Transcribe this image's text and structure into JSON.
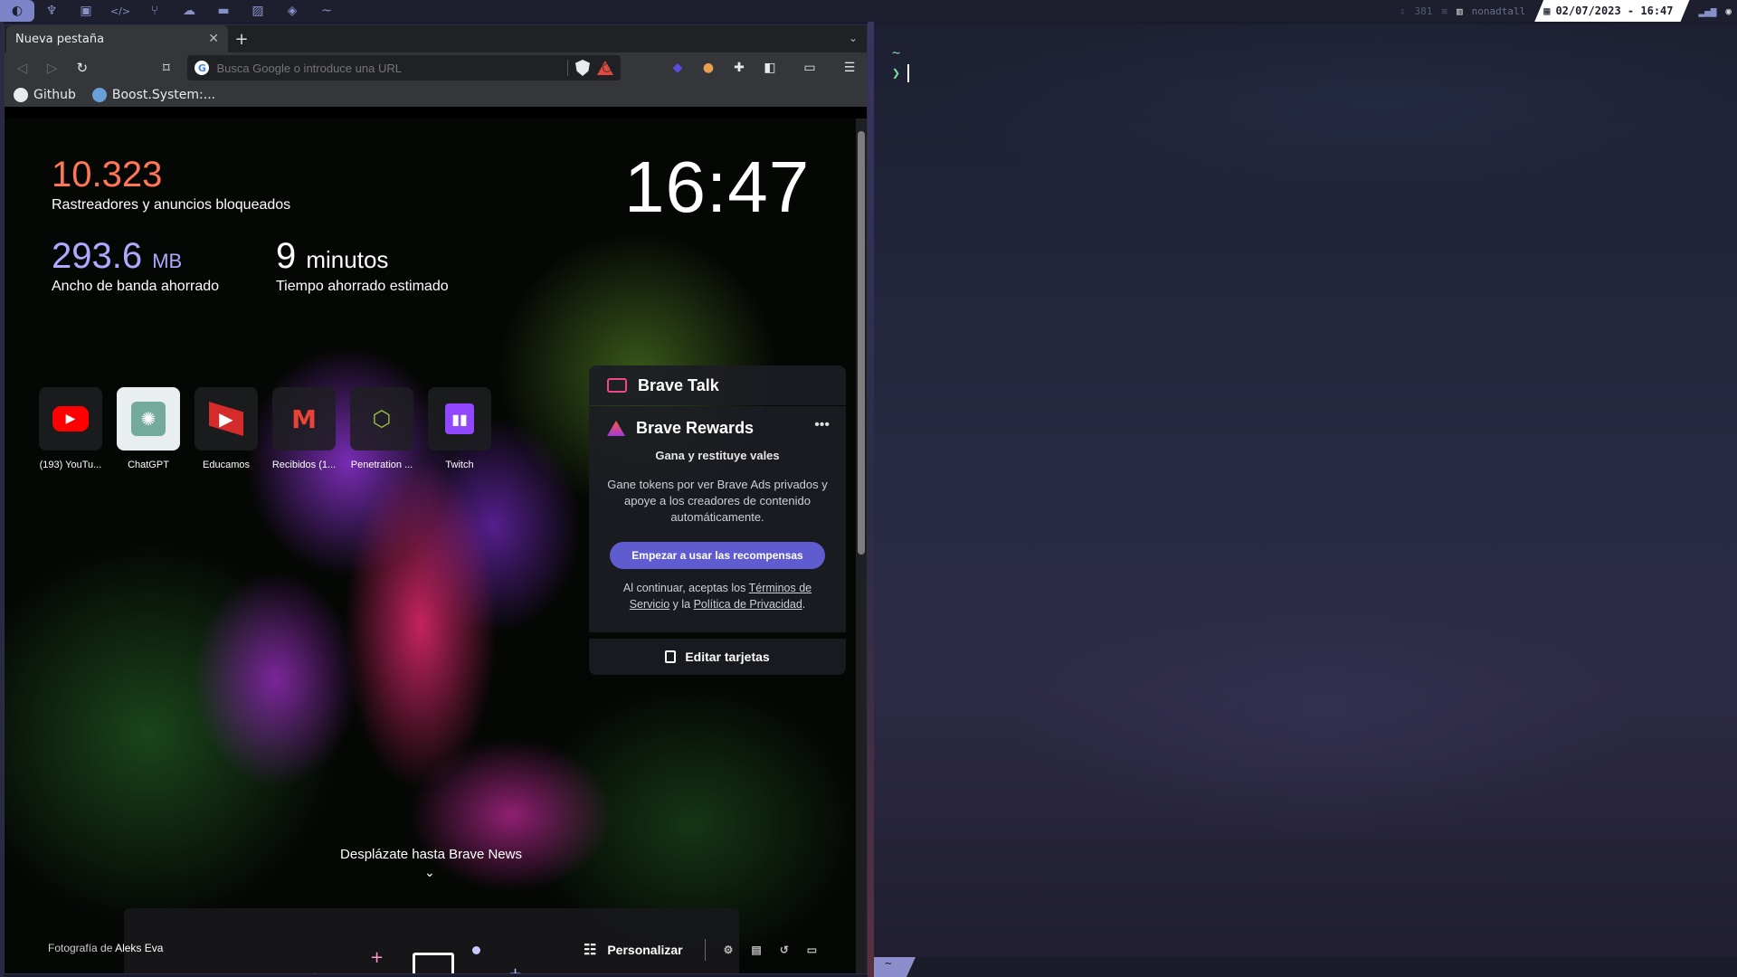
{
  "topbar": {
    "workspaces": [
      {
        "icon": "fedora-icon",
        "glyph": "◐"
      },
      {
        "icon": "python-icon",
        "glyph": "♆"
      },
      {
        "icon": "terminal-icon",
        "glyph": "▣"
      },
      {
        "icon": "code-icon",
        "glyph": "</>"
      },
      {
        "icon": "git-icon",
        "glyph": "⑂"
      },
      {
        "icon": "docker-icon",
        "glyph": "☁"
      },
      {
        "icon": "folder-icon",
        "glyph": "▬"
      },
      {
        "icon": "image-icon",
        "glyph": "▨"
      },
      {
        "icon": "layers-icon",
        "glyph": "◈"
      },
      {
        "icon": "tilde-icon",
        "glyph": "~"
      }
    ],
    "updates": "381",
    "user": "nonadtall",
    "clock": "02/07/2023 - 16:47"
  },
  "browser": {
    "tab_title": "Nueva pestaña",
    "tab_close": "✕",
    "new_tab": "+",
    "omnibox_placeholder": "Busca Google o introduce una URL",
    "bookmarks": [
      {
        "label": "Github",
        "icon": "github-icon"
      },
      {
        "label": "Boost.System:...",
        "icon": "boost-icon"
      }
    ]
  },
  "ntp": {
    "trackers_value": "10.323",
    "trackers_label": "Rastreadores y anuncios bloqueados",
    "bandwidth_value": "293.6",
    "bandwidth_unit": "MB",
    "bandwidth_label": "Ancho de banda ahorrado",
    "time_value": "9",
    "time_unit": "minutos",
    "time_label": "Tiempo ahorrado estimado",
    "clock": "16:47",
    "top_sites": [
      {
        "label": "(193) YouTu...",
        "icon": "youtube-icon"
      },
      {
        "label": "ChatGPT",
        "icon": "chatgpt-icon"
      },
      {
        "label": "Educamos",
        "icon": "educamos-icon"
      },
      {
        "label": "Recibidos (1...",
        "icon": "gmail-icon"
      },
      {
        "label": "Penetration ...",
        "icon": "cube-icon"
      },
      {
        "label": "Twitch",
        "icon": "twitch-icon"
      }
    ],
    "talk_title": "Brave Talk",
    "rewards_title": "Brave Rewards",
    "rewards_more": "•••",
    "rewards_subtitle": "Gana y restituye vales",
    "rewards_desc": "Gane tokens por ver Brave Ads privados y apoye a los creadores de contenido automáticamente.",
    "rewards_button": "Empezar a usar las recompensas",
    "terms_prefix": "Al continuar, aceptas los ",
    "terms_link": "Términos de Servicio",
    "terms_mid": " y la ",
    "privacy_link": "Política de Privacidad",
    "terms_suffix": ".",
    "edit_cards": "Editar tarjetas",
    "news_hint": "Desplázate hasta Brave News",
    "photo_prefix": "Fotografía de ",
    "photo_author": "Aleks Eva",
    "customize": "Personalizar"
  },
  "terminal": {
    "cwd": "~",
    "prompt": "❯",
    "status_tab": "~"
  },
  "colors": {
    "trackers": "#ff7654",
    "bandwidth": "#b0a8ff",
    "rewards_button": "#5f5ccf",
    "prompt": "#7ee0a0"
  }
}
